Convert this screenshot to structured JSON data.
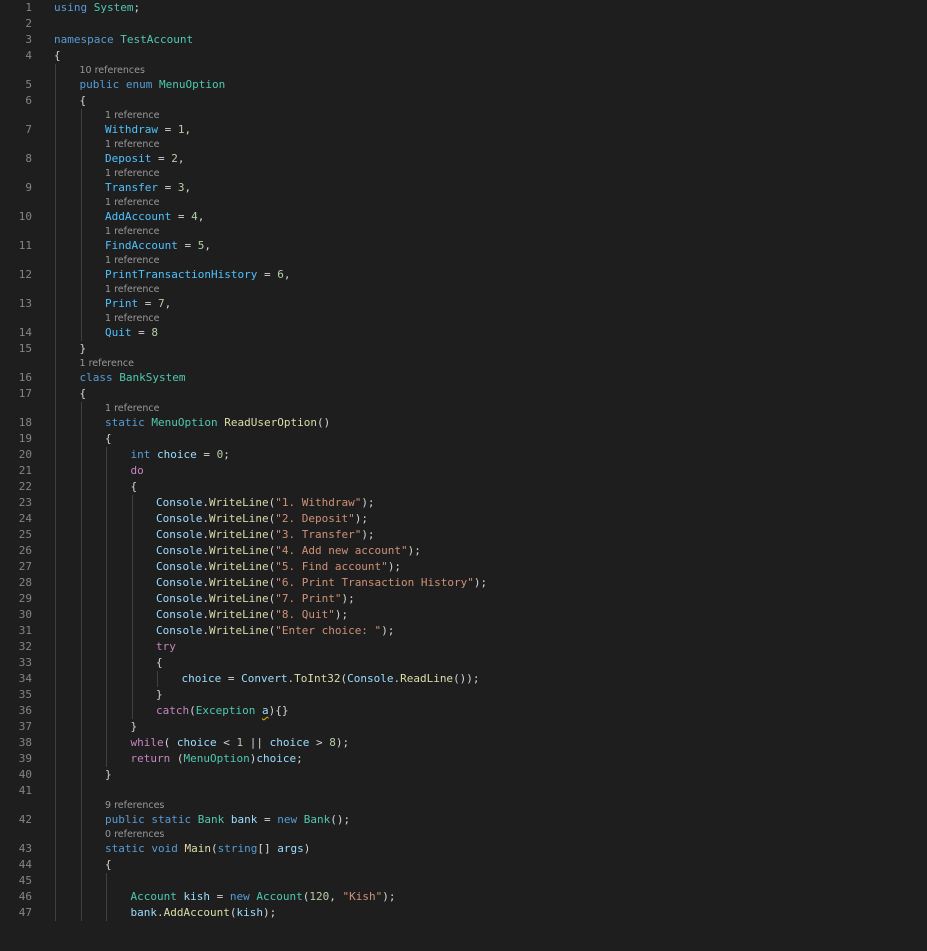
{
  "editor": {
    "language": "csharp",
    "colors": {
      "background": "#1e1e1e",
      "line_number": "#858585",
      "code_lens": "#999999",
      "keyword": "#569cd6",
      "control": "#c586c0",
      "type": "#4ec9b0",
      "method": "#dcdcaa",
      "string": "#ce9178",
      "number": "#b5cea8",
      "variable": "#9cdcfe",
      "enum_member": "#4fc1ff",
      "warning_squiggle": "#cca700"
    },
    "rows": [
      {
        "kind": "code",
        "ln": "1",
        "indent": 0,
        "tokens": [
          [
            "kw",
            "using"
          ],
          [
            "pl",
            " "
          ],
          [
            "ty",
            "System"
          ],
          [
            "pl",
            ";"
          ]
        ]
      },
      {
        "kind": "code",
        "ln": "2",
        "indent": 0,
        "tokens": []
      },
      {
        "kind": "code",
        "ln": "3",
        "indent": 0,
        "tokens": [
          [
            "kw",
            "namespace"
          ],
          [
            "pl",
            " "
          ],
          [
            "ty",
            "TestAccount"
          ]
        ]
      },
      {
        "kind": "code",
        "ln": "4",
        "indent": 0,
        "tokens": [
          [
            "pl",
            "{"
          ]
        ]
      },
      {
        "kind": "lens",
        "indent": 1,
        "text": "10 references"
      },
      {
        "kind": "code",
        "ln": "5",
        "indent": 1,
        "tokens": [
          [
            "kw",
            "public"
          ],
          [
            "pl",
            " "
          ],
          [
            "kw",
            "enum"
          ],
          [
            "pl",
            " "
          ],
          [
            "ty",
            "MenuOption"
          ]
        ]
      },
      {
        "kind": "code",
        "ln": "6",
        "indent": 1,
        "tokens": [
          [
            "pl",
            "{"
          ]
        ]
      },
      {
        "kind": "lens",
        "indent": 2,
        "text": "1 reference"
      },
      {
        "kind": "code",
        "ln": "7",
        "indent": 2,
        "tokens": [
          [
            "en",
            "Withdraw"
          ],
          [
            "pl",
            " = "
          ],
          [
            "num",
            "1"
          ],
          [
            "pl",
            ","
          ]
        ]
      },
      {
        "kind": "lens",
        "indent": 2,
        "text": "1 reference"
      },
      {
        "kind": "code",
        "ln": "8",
        "indent": 2,
        "tokens": [
          [
            "en",
            "Deposit"
          ],
          [
            "pl",
            " = "
          ],
          [
            "num",
            "2"
          ],
          [
            "pl",
            ","
          ]
        ]
      },
      {
        "kind": "lens",
        "indent": 2,
        "text": "1 reference"
      },
      {
        "kind": "code",
        "ln": "9",
        "indent": 2,
        "tokens": [
          [
            "en",
            "Transfer"
          ],
          [
            "pl",
            " = "
          ],
          [
            "num",
            "3"
          ],
          [
            "pl",
            ","
          ]
        ]
      },
      {
        "kind": "lens",
        "indent": 2,
        "text": "1 reference"
      },
      {
        "kind": "code",
        "ln": "10",
        "indent": 2,
        "tokens": [
          [
            "en",
            "AddAccount"
          ],
          [
            "pl",
            " = "
          ],
          [
            "num",
            "4"
          ],
          [
            "pl",
            ","
          ]
        ]
      },
      {
        "kind": "lens",
        "indent": 2,
        "text": "1 reference"
      },
      {
        "kind": "code",
        "ln": "11",
        "indent": 2,
        "tokens": [
          [
            "en",
            "FindAccount"
          ],
          [
            "pl",
            " = "
          ],
          [
            "num",
            "5"
          ],
          [
            "pl",
            ","
          ]
        ]
      },
      {
        "kind": "lens",
        "indent": 2,
        "text": "1 reference"
      },
      {
        "kind": "code",
        "ln": "12",
        "indent": 2,
        "tokens": [
          [
            "en",
            "PrintTransactionHistory"
          ],
          [
            "pl",
            " = "
          ],
          [
            "num",
            "6"
          ],
          [
            "pl",
            ","
          ]
        ]
      },
      {
        "kind": "lens",
        "indent": 2,
        "text": "1 reference"
      },
      {
        "kind": "code",
        "ln": "13",
        "indent": 2,
        "tokens": [
          [
            "en",
            "Print"
          ],
          [
            "pl",
            " = "
          ],
          [
            "num",
            "7"
          ],
          [
            "pl",
            ","
          ]
        ]
      },
      {
        "kind": "lens",
        "indent": 2,
        "text": "1 reference"
      },
      {
        "kind": "code",
        "ln": "14",
        "indent": 2,
        "tokens": [
          [
            "en",
            "Quit"
          ],
          [
            "pl",
            " = "
          ],
          [
            "num",
            "8"
          ]
        ]
      },
      {
        "kind": "code",
        "ln": "15",
        "indent": 1,
        "tokens": [
          [
            "pl",
            "}"
          ]
        ]
      },
      {
        "kind": "lens",
        "indent": 1,
        "text": "1 reference"
      },
      {
        "kind": "code",
        "ln": "16",
        "indent": 1,
        "tokens": [
          [
            "kw",
            "class"
          ],
          [
            "pl",
            " "
          ],
          [
            "ty",
            "BankSystem"
          ]
        ]
      },
      {
        "kind": "code",
        "ln": "17",
        "indent": 1,
        "tokens": [
          [
            "pl",
            "{"
          ]
        ]
      },
      {
        "kind": "lens",
        "indent": 2,
        "text": "1 reference"
      },
      {
        "kind": "code",
        "ln": "18",
        "indent": 2,
        "tokens": [
          [
            "kw",
            "static"
          ],
          [
            "pl",
            " "
          ],
          [
            "ty",
            "MenuOption"
          ],
          [
            "pl",
            " "
          ],
          [
            "fn",
            "ReadUserOption"
          ],
          [
            "pl",
            "()"
          ]
        ]
      },
      {
        "kind": "code",
        "ln": "19",
        "indent": 2,
        "tokens": [
          [
            "pl",
            "{"
          ]
        ]
      },
      {
        "kind": "code",
        "ln": "20",
        "indent": 3,
        "tokens": [
          [
            "kw",
            "int"
          ],
          [
            "pl",
            " "
          ],
          [
            "id",
            "choice"
          ],
          [
            "pl",
            " = "
          ],
          [
            "num",
            "0"
          ],
          [
            "pl",
            ";"
          ]
        ]
      },
      {
        "kind": "code",
        "ln": "21",
        "indent": 3,
        "tokens": [
          [
            "ctl",
            "do"
          ]
        ]
      },
      {
        "kind": "code",
        "ln": "22",
        "indent": 3,
        "tokens": [
          [
            "pl",
            "{"
          ]
        ]
      },
      {
        "kind": "code",
        "ln": "23",
        "indent": 4,
        "tokens": [
          [
            "id",
            "Console"
          ],
          [
            "pl",
            "."
          ],
          [
            "fn",
            "WriteLine"
          ],
          [
            "pl",
            "("
          ],
          [
            "str",
            "\"1. Withdraw\""
          ],
          [
            "pl",
            ");"
          ]
        ]
      },
      {
        "kind": "code",
        "ln": "24",
        "indent": 4,
        "tokens": [
          [
            "id",
            "Console"
          ],
          [
            "pl",
            "."
          ],
          [
            "fn",
            "WriteLine"
          ],
          [
            "pl",
            "("
          ],
          [
            "str",
            "\"2. Deposit\""
          ],
          [
            "pl",
            ");"
          ]
        ]
      },
      {
        "kind": "code",
        "ln": "25",
        "indent": 4,
        "tokens": [
          [
            "id",
            "Console"
          ],
          [
            "pl",
            "."
          ],
          [
            "fn",
            "WriteLine"
          ],
          [
            "pl",
            "("
          ],
          [
            "str",
            "\"3. Transfer\""
          ],
          [
            "pl",
            ");"
          ]
        ]
      },
      {
        "kind": "code",
        "ln": "26",
        "indent": 4,
        "tokens": [
          [
            "id",
            "Console"
          ],
          [
            "pl",
            "."
          ],
          [
            "fn",
            "WriteLine"
          ],
          [
            "pl",
            "("
          ],
          [
            "str",
            "\"4. Add new account\""
          ],
          [
            "pl",
            ");"
          ]
        ]
      },
      {
        "kind": "code",
        "ln": "27",
        "indent": 4,
        "tokens": [
          [
            "id",
            "Console"
          ],
          [
            "pl",
            "."
          ],
          [
            "fn",
            "WriteLine"
          ],
          [
            "pl",
            "("
          ],
          [
            "str",
            "\"5. Find account\""
          ],
          [
            "pl",
            ");"
          ]
        ]
      },
      {
        "kind": "code",
        "ln": "28",
        "indent": 4,
        "tokens": [
          [
            "id",
            "Console"
          ],
          [
            "pl",
            "."
          ],
          [
            "fn",
            "WriteLine"
          ],
          [
            "pl",
            "("
          ],
          [
            "str",
            "\"6. Print Transaction History\""
          ],
          [
            "pl",
            ");"
          ]
        ]
      },
      {
        "kind": "code",
        "ln": "29",
        "indent": 4,
        "tokens": [
          [
            "id",
            "Console"
          ],
          [
            "pl",
            "."
          ],
          [
            "fn",
            "WriteLine"
          ],
          [
            "pl",
            "("
          ],
          [
            "str",
            "\"7. Print\""
          ],
          [
            "pl",
            ");"
          ]
        ]
      },
      {
        "kind": "code",
        "ln": "30",
        "indent": 4,
        "tokens": [
          [
            "id",
            "Console"
          ],
          [
            "pl",
            "."
          ],
          [
            "fn",
            "WriteLine"
          ],
          [
            "pl",
            "("
          ],
          [
            "str",
            "\"8. Quit\""
          ],
          [
            "pl",
            ");"
          ]
        ]
      },
      {
        "kind": "code",
        "ln": "31",
        "indent": 4,
        "tokens": [
          [
            "id",
            "Console"
          ],
          [
            "pl",
            "."
          ],
          [
            "fn",
            "WriteLine"
          ],
          [
            "pl",
            "("
          ],
          [
            "str",
            "\"Enter choice: \""
          ],
          [
            "pl",
            ");"
          ]
        ]
      },
      {
        "kind": "code",
        "ln": "32",
        "indent": 4,
        "tokens": [
          [
            "ctl",
            "try"
          ]
        ]
      },
      {
        "kind": "code",
        "ln": "33",
        "indent": 4,
        "tokens": [
          [
            "pl",
            "{"
          ]
        ]
      },
      {
        "kind": "code",
        "ln": "34",
        "indent": 5,
        "tokens": [
          [
            "id",
            "choice"
          ],
          [
            "pl",
            " = "
          ],
          [
            "id",
            "Convert"
          ],
          [
            "pl",
            "."
          ],
          [
            "fn",
            "ToInt32"
          ],
          [
            "pl",
            "("
          ],
          [
            "id",
            "Console"
          ],
          [
            "pl",
            "."
          ],
          [
            "fn",
            "ReadLine"
          ],
          [
            "pl",
            "());"
          ]
        ]
      },
      {
        "kind": "code",
        "ln": "35",
        "indent": 4,
        "tokens": [
          [
            "pl",
            "}"
          ]
        ]
      },
      {
        "kind": "code",
        "ln": "36",
        "indent": 4,
        "tokens": [
          [
            "ctl",
            "catch"
          ],
          [
            "pl",
            "("
          ],
          [
            "ty",
            "Exception"
          ],
          [
            "pl",
            " "
          ],
          [
            "id sq",
            "a"
          ],
          [
            "pl",
            "){}"
          ]
        ]
      },
      {
        "kind": "code",
        "ln": "37",
        "indent": 3,
        "tokens": [
          [
            "pl",
            "}"
          ]
        ]
      },
      {
        "kind": "code",
        "ln": "38",
        "indent": 3,
        "tokens": [
          [
            "ctl",
            "while"
          ],
          [
            "pl",
            "( "
          ],
          [
            "id",
            "choice"
          ],
          [
            "pl",
            " < "
          ],
          [
            "num",
            "1"
          ],
          [
            "pl",
            " || "
          ],
          [
            "id",
            "choice"
          ],
          [
            "pl",
            " > "
          ],
          [
            "num",
            "8"
          ],
          [
            "pl",
            ");"
          ]
        ]
      },
      {
        "kind": "code",
        "ln": "39",
        "indent": 3,
        "tokens": [
          [
            "ctl",
            "return"
          ],
          [
            "pl",
            " ("
          ],
          [
            "ty",
            "MenuOption"
          ],
          [
            "pl",
            ")"
          ],
          [
            "id",
            "choice"
          ],
          [
            "pl",
            ";"
          ]
        ]
      },
      {
        "kind": "code",
        "ln": "40",
        "indent": 2,
        "tokens": [
          [
            "pl",
            "}"
          ]
        ]
      },
      {
        "kind": "code",
        "ln": "41",
        "indent": 2,
        "tokens": []
      },
      {
        "kind": "lens",
        "indent": 2,
        "text": "9 references"
      },
      {
        "kind": "code",
        "ln": "42",
        "indent": 2,
        "tokens": [
          [
            "kw",
            "public"
          ],
          [
            "pl",
            " "
          ],
          [
            "kw",
            "static"
          ],
          [
            "pl",
            " "
          ],
          [
            "ty",
            "Bank"
          ],
          [
            "pl",
            " "
          ],
          [
            "id",
            "bank"
          ],
          [
            "pl",
            " = "
          ],
          [
            "kw",
            "new"
          ],
          [
            "pl",
            " "
          ],
          [
            "ty",
            "Bank"
          ],
          [
            "pl",
            "();"
          ]
        ]
      },
      {
        "kind": "lens",
        "indent": 2,
        "text": "0 references"
      },
      {
        "kind": "code",
        "ln": "43",
        "indent": 2,
        "tokens": [
          [
            "kw",
            "static"
          ],
          [
            "pl",
            " "
          ],
          [
            "kw",
            "void"
          ],
          [
            "pl",
            " "
          ],
          [
            "fn",
            "Main"
          ],
          [
            "pl",
            "("
          ],
          [
            "kw",
            "string"
          ],
          [
            "pl",
            "[] "
          ],
          [
            "id",
            "args"
          ],
          [
            "pl",
            ")"
          ]
        ]
      },
      {
        "kind": "code",
        "ln": "44",
        "indent": 2,
        "tokens": [
          [
            "pl",
            "{"
          ]
        ]
      },
      {
        "kind": "code",
        "ln": "45",
        "indent": 3,
        "tokens": []
      },
      {
        "kind": "code",
        "ln": "46",
        "indent": 3,
        "tokens": [
          [
            "ty",
            "Account"
          ],
          [
            "pl",
            " "
          ],
          [
            "id",
            "kish"
          ],
          [
            "pl",
            " = "
          ],
          [
            "kw",
            "new"
          ],
          [
            "pl",
            " "
          ],
          [
            "ty",
            "Account"
          ],
          [
            "pl",
            "("
          ],
          [
            "num",
            "120"
          ],
          [
            "pl",
            ", "
          ],
          [
            "str",
            "\"Kish\""
          ],
          [
            "pl",
            ");"
          ]
        ]
      },
      {
        "kind": "code",
        "ln": "47",
        "indent": 3,
        "tokens": [
          [
            "id",
            "bank"
          ],
          [
            "pl",
            "."
          ],
          [
            "fn",
            "AddAccount"
          ],
          [
            "pl",
            "("
          ],
          [
            "id",
            "kish"
          ],
          [
            "pl",
            ");"
          ]
        ]
      }
    ]
  }
}
